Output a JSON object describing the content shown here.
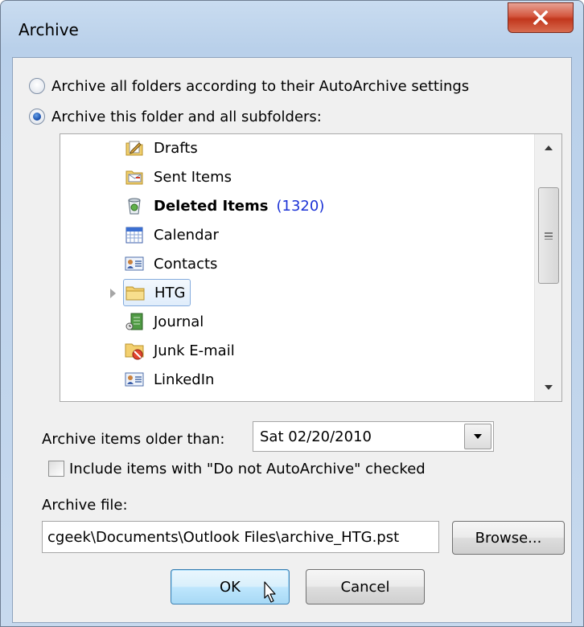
{
  "window": {
    "title": "Archive",
    "close_glyph": "X"
  },
  "options": {
    "archive_all_label": "Archive all folders according to their AutoArchive settings",
    "archive_this_label": "Archive this folder and all subfolders:",
    "selected": "archive_this"
  },
  "folders": [
    {
      "name": "Drafts",
      "icon": "drafts-icon"
    },
    {
      "name": "Sent Items",
      "icon": "sent-items-icon"
    },
    {
      "name": "Deleted Items",
      "count": "(1320)",
      "bold": true,
      "icon": "deleted-items-icon"
    },
    {
      "name": "Calendar",
      "icon": "calendar-icon"
    },
    {
      "name": "Contacts",
      "icon": "contacts-icon"
    },
    {
      "name": "HTG",
      "icon": "folder-icon",
      "selected": true,
      "expandable": true
    },
    {
      "name": "Journal",
      "icon": "journal-icon"
    },
    {
      "name": "Junk E-mail",
      "icon": "junk-email-icon"
    },
    {
      "name": "LinkedIn",
      "icon": "contacts-icon"
    }
  ],
  "older_than": {
    "label": "Archive items older than:",
    "value": "Sat 02/20/2010"
  },
  "include_checkbox": {
    "label": "Include items with \"Do not AutoArchive\" checked",
    "checked": false
  },
  "archive_file": {
    "label": "Archive file:",
    "value": "cgeek\\Documents\\Outlook Files\\archive_HTG.pst"
  },
  "buttons": {
    "browse": "Browse...",
    "ok": "OK",
    "cancel": "Cancel"
  },
  "colors": {
    "accent_blue": "#1c33d6",
    "close_red": "#c2371d",
    "selection_border": "#84acdd"
  }
}
